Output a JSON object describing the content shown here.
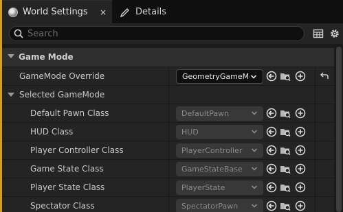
{
  "tabs": [
    {
      "label": "World Settings",
      "icon": "globe-icon",
      "close": "×"
    },
    {
      "label": "Details",
      "icon": "pencil-icon"
    }
  ],
  "search": {
    "placeholder": "Search"
  },
  "toolbar": {
    "icons": [
      "table-view-icon",
      "settings-gear-icon"
    ]
  },
  "category": {
    "label": "Game Mode"
  },
  "override": {
    "label": "GameMode Override",
    "value": "GeometryGameMode"
  },
  "subcategory": {
    "label": "Selected GameMode"
  },
  "properties": [
    {
      "label": "Default Pawn Class",
      "value": "DefaultPawn"
    },
    {
      "label": "HUD Class",
      "value": "HUD"
    },
    {
      "label": "Player Controller Class",
      "value": "PlayerController"
    },
    {
      "label": "Game State Class",
      "value": "GameStateBase"
    },
    {
      "label": "Player State Class",
      "value": "PlayerState"
    },
    {
      "label": "Spectator Class",
      "value": "SpectatorPawn"
    }
  ],
  "row_actions": [
    "use-selected-icon",
    "browse-folder-icon",
    "add-new-icon"
  ],
  "colors": {
    "accent": "#d89e1a",
    "panel": "#242424",
    "category": "#2f2f2f"
  }
}
